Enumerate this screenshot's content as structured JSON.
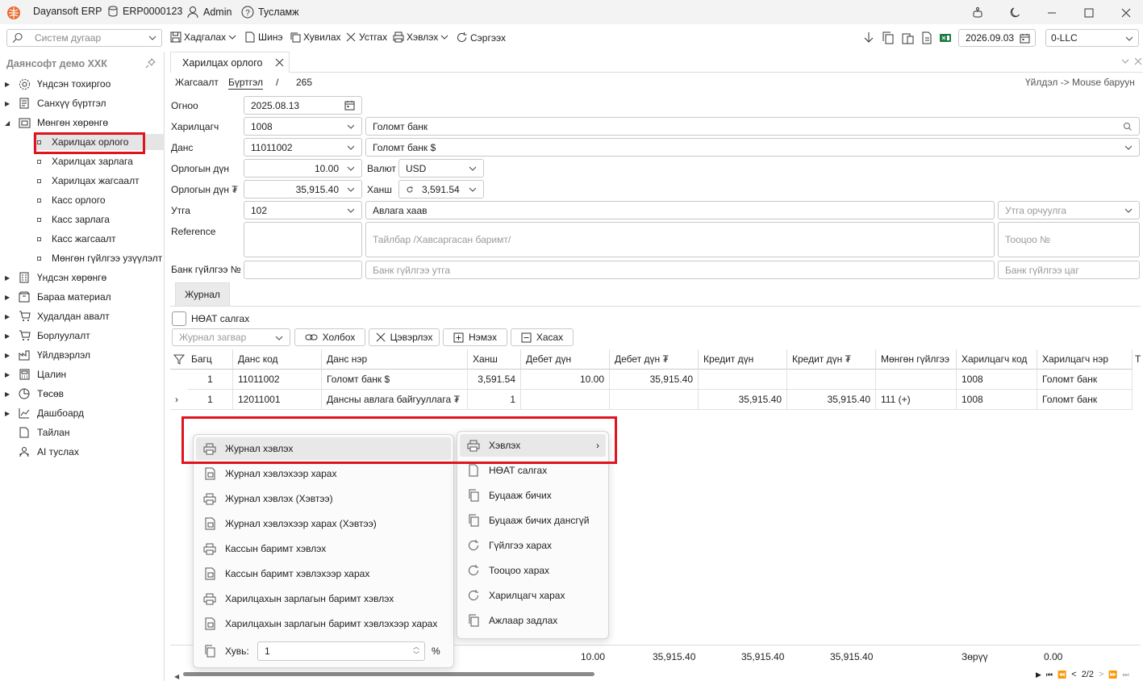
{
  "app": {
    "name": "Dayansoft ERP",
    "db": "ERP0000123",
    "user": "Admin",
    "help": "Тусламж"
  },
  "toolbar": {
    "search_placeholder": "Систем дугаар",
    "save": "Хадгалах",
    "new": "Шинэ",
    "copy": "Хувилах",
    "delete": "Устгах",
    "print": "Хэвлэх",
    "refresh": "Сэргээх",
    "date": "2026.09.03",
    "company": "0-LLC"
  },
  "sidebar": {
    "header": "Даянсофт демо ХХК",
    "items": [
      {
        "label": "Үндсэн тохиргоо",
        "icon": "gear-icon"
      },
      {
        "label": "Санхүү бүртгэл",
        "icon": "finance-icon"
      },
      {
        "label": "Мөнгөн хөрөнгө",
        "icon": "money-icon"
      },
      {
        "label": "Үндсэн хөрөнгө",
        "icon": "building-icon"
      },
      {
        "label": "Бараа материал",
        "icon": "box-icon"
      },
      {
        "label": "Худалдан авалт",
        "icon": "cart-icon"
      },
      {
        "label": "Борлуулалт",
        "icon": "cart-icon"
      },
      {
        "label": "Үйлдвэрлэл",
        "icon": "factory-icon"
      },
      {
        "label": "Цалин",
        "icon": "calculator-icon"
      },
      {
        "label": "Төсөв",
        "icon": "piechart-icon"
      },
      {
        "label": "Дашбоард",
        "icon": "dashboard-icon"
      },
      {
        "label": "Тайлан",
        "icon": "report-icon"
      },
      {
        "label": "AI туслах",
        "icon": "robot-icon"
      }
    ],
    "sub_items": [
      "Харилцах орлого",
      "Харилцах зарлага",
      "Харилцах жагсаалт",
      "Касс орлого",
      "Касс зарлага",
      "Касс жагсаалт",
      "Мөнгөн гүйлгээ узүүлэлт"
    ]
  },
  "tab": {
    "title": "Харилцах орлого"
  },
  "breadcrumb": {
    "list": "Жагсаалт",
    "register": "Бүртгэл",
    "sep": "/",
    "id": "265",
    "hint": "Үйлдэл -> Mouse баруун"
  },
  "form": {
    "date_label": "Огноо",
    "date": "2025.08.13",
    "partner_label": "Харилцагч",
    "partner_code": "1008",
    "partner_name": "Голомт банк",
    "account_label": "Данс",
    "account_code": "11011002",
    "account_name": "Голомт банк $",
    "amount_label": "Орлогын дүн",
    "amount": "10.00",
    "currency_label": "Валют",
    "currency": "USD",
    "amount_mnt_label": "Орлогын дүн ₮",
    "amount_mnt": "35,915.40",
    "rate_label": "Ханш",
    "rate": "3,591.54",
    "purpose_label": "Утга",
    "purpose_code": "102",
    "purpose_text": "Авлага хаав",
    "purpose_translate_ph": "Утга орчуулга",
    "reference_label": "Reference",
    "desc_ph": "Тайлбар /Хавсаргасан баримт/",
    "count_ph": "Тооцоо №",
    "bank_tx_label": "Банк гүйлгээ №",
    "bank_tx_purpose_ph": "Банк гүйлгээ утга",
    "bank_tx_time_ph": "Банк гүйлгээ цаг"
  },
  "journal": {
    "tab": "Журнал",
    "vat_label": "НӨАТ салгах",
    "template_ph": "Журнал загвар",
    "link": "Холбох",
    "clear": "Цэвэрлэх",
    "add": "Нэмэх",
    "remove": "Хасах",
    "columns": [
      "Багц",
      "Данс код",
      "Данс нэр",
      "Ханш",
      "Дебет дүн",
      "Дебет дүн ₮",
      "Кредит дүн",
      "Кредит дүн ₮",
      "Мөнгөн гүйлгээ",
      "Харилцагч код",
      "Харилцагч нэр",
      "Т"
    ],
    "rows": [
      [
        "1",
        "11011002",
        "Голомт банк $",
        "3,591.54",
        "10.00",
        "35,915.40",
        "",
        "",
        "",
        "1008",
        "Голомт банк"
      ],
      [
        "1",
        "12011001",
        "Дансны авлага байгууллага ₮",
        "1",
        "",
        "",
        "35,915.40",
        "35,915.40",
        "111 (+)",
        "1008",
        "Голомт банк"
      ]
    ],
    "totals": {
      "debit": "10.00",
      "debit_mnt": "35,915.40",
      "credit": "35,915.40",
      "credit_mnt": "35,915.40",
      "diff_label": "Зөрүү",
      "diff": "0.00"
    },
    "pager": "2/2"
  },
  "menu_print": {
    "items": [
      "Журнал хэвлэх",
      "Журнал хэвлэхээр харах",
      "Журнал хэвлэх (Хэвтээ)",
      "Журнал хэвлэхээр харах (Хэвтээ)",
      "Кассын баримт хэвлэх",
      "Кассын баримт хэвлэхээр харах",
      "Харилцахын зарлагын баримт хэвлэх",
      "Харилцахын зарлагын баримт хэвлэхээр харах"
    ],
    "copies_label": "Хувь:",
    "copies": "1",
    "pct": "%"
  },
  "menu_main": {
    "items": [
      "Хэвлэх",
      "НӨАТ салгах",
      "Буцааж бичих",
      "Буцааж бичих дансгүй",
      "Гүйлгээ харах",
      "Тооцоо харах",
      "Харилцагч харах",
      "Ажлаар задлах"
    ]
  },
  "colors": {
    "accent": "#e0141e",
    "logo": "#e8692c"
  }
}
